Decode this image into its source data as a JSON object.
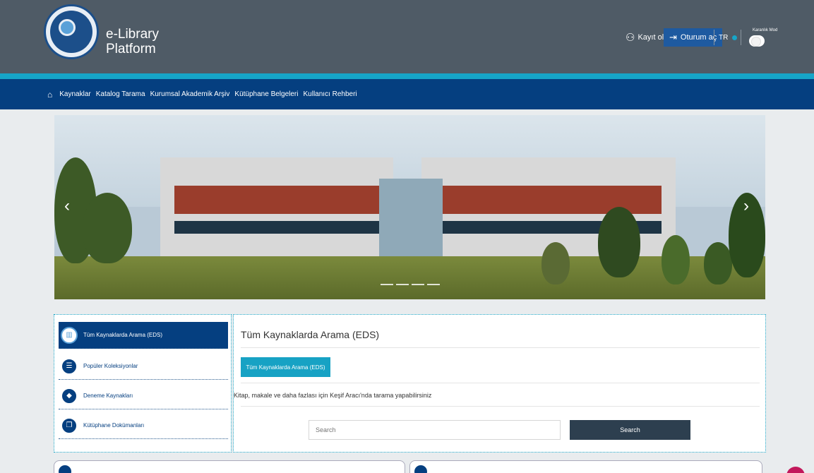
{
  "header": {
    "brand_line1": "e-Library",
    "brand_line2": "Platform",
    "signup_label": "Kayıt ol",
    "login_label": "Oturum aç",
    "language": "TR",
    "dark_mode_label": "Karanlık Mod"
  },
  "nav": {
    "items": [
      "Kaynaklar",
      "Katalog Tarama",
      "Kurumsal Akademik Arşiv",
      "Kütüphane Belgeleri",
      "Kullanıcı Rehberi"
    ]
  },
  "sidebar": {
    "items": [
      {
        "label": "Tüm Kaynaklarda Arama (EDS)",
        "icon": "library-icon",
        "active": true
      },
      {
        "label": "Popüler Koleksiyonlar",
        "icon": "list-icon",
        "active": false
      },
      {
        "label": "Deneme Kaynakları",
        "icon": "tag-icon",
        "active": false
      },
      {
        "label": "Kütüphane Dokümanları",
        "icon": "document-icon",
        "active": false
      }
    ]
  },
  "main": {
    "title": "Tüm Kaynaklarda Arama (EDS)",
    "tab_button": "Tüm Kaynaklarda Arama (EDS)",
    "description": "Kitap, makale ve daha fazlası için Keşif Aracı'nda tarama yapabilirsiniz",
    "search_placeholder": "Search",
    "search_button": "Search"
  },
  "colors": {
    "header_bg": "#4f5b66",
    "nav_bg": "#053f80",
    "accent": "#16a5c8",
    "search_button_bg": "#2d3f4f"
  }
}
